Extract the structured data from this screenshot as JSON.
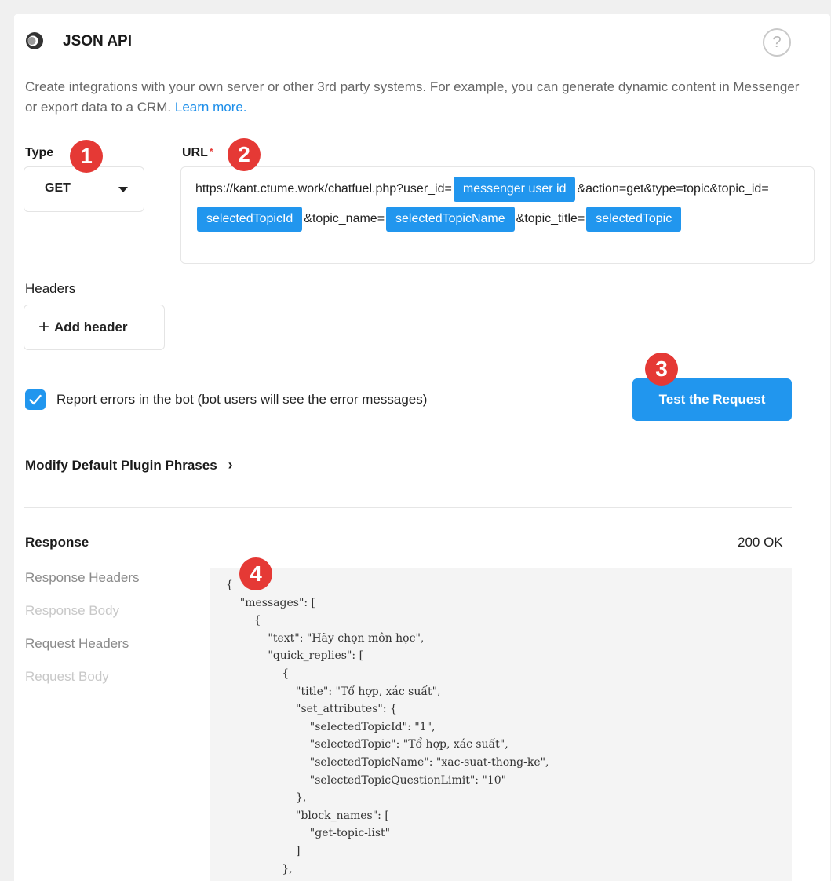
{
  "header": {
    "title": "JSON API",
    "help_glyph": "?"
  },
  "description": {
    "text": "Create integrations with your own server or other 3rd party systems. For example, you can generate dynamic content in Messenger or export data to a CRM.",
    "link": "Learn more."
  },
  "type_field": {
    "label": "Type",
    "value": "GET"
  },
  "url_field": {
    "label": "URL",
    "required_mark": "*",
    "segments": [
      {
        "kind": "text",
        "value": "https://kant.ctume.work/chatfuel.php?user_id="
      },
      {
        "kind": "chip",
        "value": "messenger user id"
      },
      {
        "kind": "text",
        "value": "&action=get&type=topic&topic_id="
      },
      {
        "kind": "chip",
        "value": "selectedTopicId"
      },
      {
        "kind": "text",
        "value": "&topic_name="
      },
      {
        "kind": "chip",
        "value": "selectedTopicName"
      },
      {
        "kind": "text",
        "value": "&topic_title="
      },
      {
        "kind": "chip",
        "value": "selectedTopic"
      }
    ]
  },
  "headers": {
    "label": "Headers",
    "add_button": "Add header",
    "add_glyph": "+"
  },
  "report_errors": {
    "checked": true,
    "label": "Report errors in the bot (bot users will see the error messages)"
  },
  "test_button": "Test the Request",
  "modify_phrases": {
    "label": "Modify Default Plugin Phrases",
    "chevron": "›"
  },
  "response": {
    "label": "Response",
    "status": "200 OK",
    "tabs": [
      {
        "label": "Response Headers",
        "color": "#8a8a8a"
      },
      {
        "label": "Response Body",
        "color": "#c8c8c8"
      },
      {
        "label": "Request Headers",
        "color": "#8a8a8a"
      },
      {
        "label": "Request Body",
        "color": "#c8c8c8"
      }
    ],
    "code_lines": [
      "{",
      "    \"messages\": [",
      "        {",
      "            \"text\": \"Hãy chọn môn học\",",
      "            \"quick_replies\": [",
      "                {",
      "                    \"title\": \"Tổ hợp, xác suất\",",
      "                    \"set_attributes\": {",
      "                        \"selectedTopicId\": \"1\",",
      "                        \"selectedTopic\": \"Tổ hợp, xác suất\",",
      "                        \"selectedTopicName\": \"xac-suat-thong-ke\",",
      "                        \"selectedTopicQuestionLimit\": \"10\"",
      "                    },",
      "                    \"block_names\": [",
      "                        \"get-topic-list\"",
      "                    ]",
      "                },"
    ]
  },
  "annotations": [
    "1",
    "2",
    "3",
    "4"
  ],
  "colors": {
    "accent": "#2196ee",
    "badge": "#e53935",
    "link": "#1a8de9"
  }
}
